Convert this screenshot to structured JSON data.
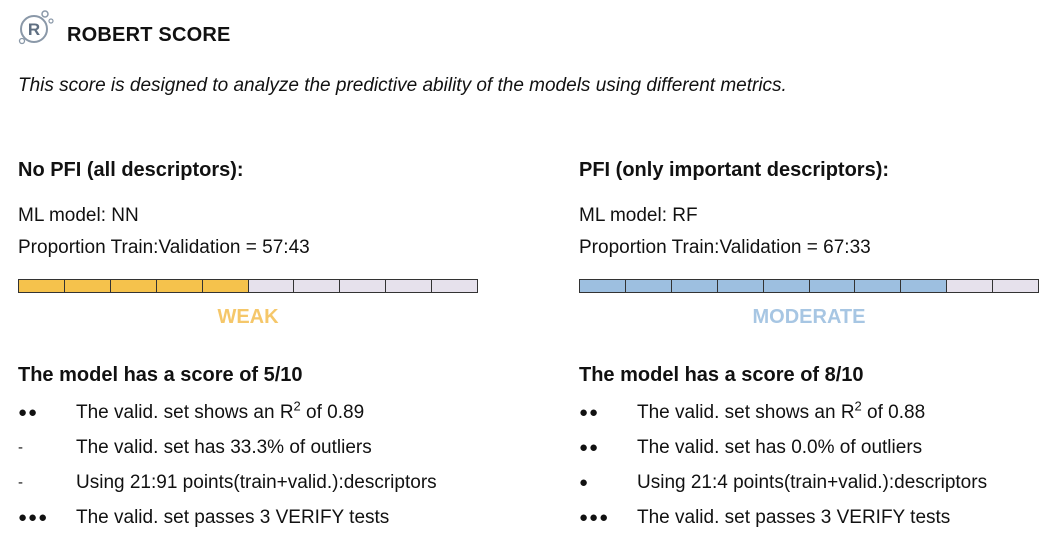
{
  "header": {
    "logo_letter": "R",
    "title": "ROBERT SCORE",
    "description": "This score is designed to analyze the predictive ability of the models using different metrics."
  },
  "colors": {
    "weak_fill": "#f5c24c",
    "moderate_fill": "#9dbfe0",
    "empty_fill": "#e6e1ec",
    "weak_text": "#f5c76a",
    "moderate_text": "#a7c6e3"
  },
  "left": {
    "heading": "No PFI (all descriptors):",
    "model_prefix": "ML model: ",
    "model": "NN",
    "split_prefix": "Proportion Train:Validation = ",
    "split": "57:43",
    "score": 5,
    "max_score": 10,
    "rating": "WEAK",
    "score_prefix": "The model has a score of ",
    "score_text": "5/10",
    "metrics": [
      {
        "marker": "●●",
        "text": "The valid. set shows an R",
        "sup": "2",
        "after": " of 0.89"
      },
      {
        "marker": "-",
        "text": "The valid. set has 33.3% of outliers",
        "sup": "",
        "after": ""
      },
      {
        "marker": "-",
        "text": "Using 21:91 points(train+valid.):descriptors",
        "sup": "",
        "after": ""
      },
      {
        "marker": "●●●",
        "text": "The valid. set passes 3 VERIFY tests",
        "sup": "",
        "after": ""
      }
    ]
  },
  "right": {
    "heading": "PFI (only important descriptors):",
    "model_prefix": "ML model: ",
    "model": "RF",
    "split_prefix": "Proportion Train:Validation = ",
    "split": "67:33",
    "score": 8,
    "max_score": 10,
    "rating": "MODERATE",
    "score_prefix": "The model has a score of ",
    "score_text": "8/10",
    "metrics": [
      {
        "marker": "●●",
        "text": "The valid. set shows an R",
        "sup": "2",
        "after": " of 0.88"
      },
      {
        "marker": "●●",
        "text": "The valid. set has 0.0% of outliers",
        "sup": "",
        "after": ""
      },
      {
        "marker": "●",
        "text": "Using 21:4 points(train+valid.):descriptors",
        "sup": "",
        "after": ""
      },
      {
        "marker": "●●●",
        "text": "The valid. set passes 3 VERIFY tests",
        "sup": "",
        "after": ""
      }
    ]
  }
}
